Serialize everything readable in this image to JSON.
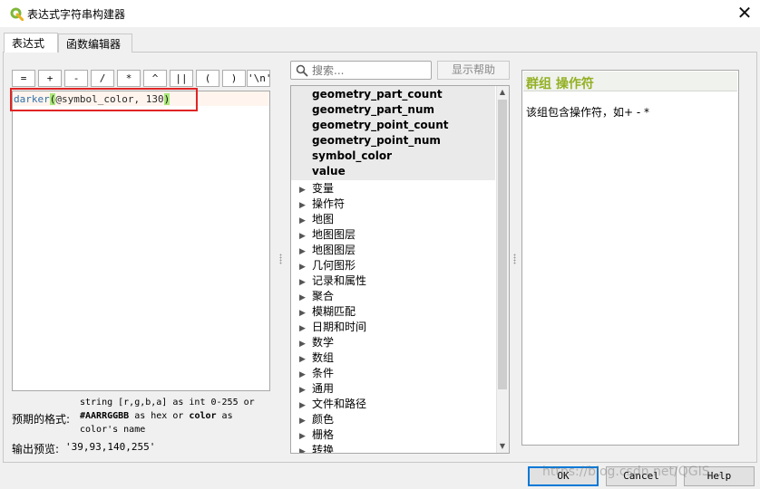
{
  "window": {
    "title": "表达式字符串构建器",
    "close_glyph": "✕"
  },
  "tabs": [
    {
      "label": "表达式"
    },
    {
      "label": "函数编辑器"
    }
  ],
  "operators": [
    "=",
    "+",
    "-",
    "/",
    "*",
    "^",
    "||",
    "(",
    ")",
    "'\\n'"
  ],
  "expression": {
    "fn": "darker",
    "open": "(",
    "var": "@symbol_color",
    "sep": ", ",
    "num": "130",
    "close": ")"
  },
  "format": {
    "label": "预期的格式:",
    "line1": "string [r,g,b,a] as int 0-255 or",
    "line2_bold": "#AARRGGBB",
    "line2_mid": " as hex or ",
    "line2_bold2": "color",
    "line2_end": " as",
    "line3": "color's name"
  },
  "preview": {
    "label": "输出预览:",
    "value": "'39,93,140,255'"
  },
  "search": {
    "placeholder": "搜索...",
    "help_button": "显示帮助"
  },
  "functions": [
    "geometry_part_count",
    "geometry_part_num",
    "geometry_point_count",
    "geometry_point_num",
    "symbol_color",
    "value"
  ],
  "groups": [
    "变量",
    "操作符",
    "地图",
    "地图图层",
    "地图图层",
    "几何图形",
    "记录和属性",
    "聚合",
    "模糊匹配",
    "日期和时间",
    "数学",
    "数组",
    "条件",
    "通用",
    "文件和路径",
    "颜色",
    "栅格",
    "转换"
  ],
  "help": {
    "title": "群组 操作符",
    "body": "该组包含操作符，如+ - *"
  },
  "buttons": {
    "ok": "OK",
    "cancel": "Cancel",
    "help": "Help"
  },
  "watermark": "https://blog.csdn.net/QGIS..."
}
